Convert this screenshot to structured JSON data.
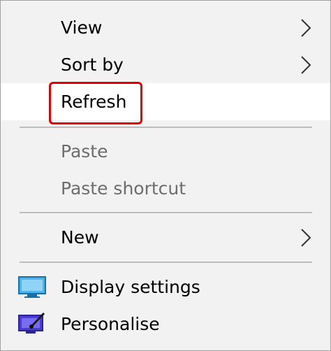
{
  "menu": {
    "items": [
      {
        "label": "View",
        "icon": null,
        "has_submenu": true,
        "enabled": true
      },
      {
        "label": "Sort by",
        "icon": null,
        "has_submenu": true,
        "enabled": true
      },
      {
        "label": "Refresh",
        "icon": null,
        "has_submenu": false,
        "enabled": true,
        "highlighted": true
      },
      {
        "label": "Paste",
        "icon": null,
        "has_submenu": false,
        "enabled": false
      },
      {
        "label": "Paste shortcut",
        "icon": null,
        "has_submenu": false,
        "enabled": false
      },
      {
        "label": "New",
        "icon": null,
        "has_submenu": true,
        "enabled": true
      },
      {
        "label": "Display settings",
        "icon": "display-settings-icon",
        "has_submenu": false,
        "enabled": true
      },
      {
        "label": "Personalise",
        "icon": "personalise-icon",
        "has_submenu": false,
        "enabled": true
      }
    ]
  },
  "colors": {
    "menu_background": "#f2f2f2",
    "hover_background": "#ffffff",
    "disabled_text": "#6d6d6d",
    "annotation_outline": "#e30000"
  }
}
